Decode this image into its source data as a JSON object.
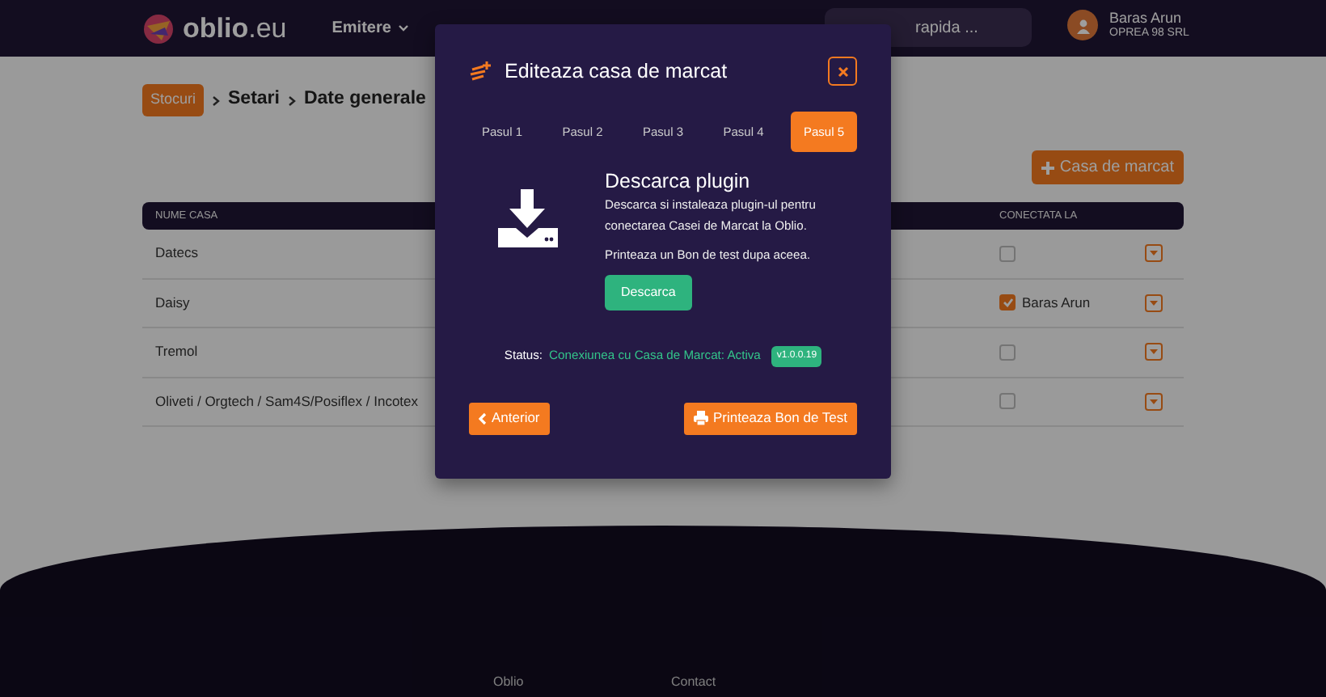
{
  "navbar": {
    "brand": "oblio.eu",
    "menu": [
      {
        "label": "Emitere",
        "dropdown": true
      }
    ],
    "search": {
      "placeholder": "rapida ..."
    },
    "user": {
      "name": "Baras Arun",
      "company": "OPREA 98 SRL"
    }
  },
  "breadcrumb": [
    {
      "label": "Stocuri",
      "kind": "badge"
    },
    {
      "label": "Setari",
      "kind": "text"
    },
    {
      "label": "Date generale",
      "kind": "text"
    }
  ],
  "add_button": {
    "label": "Casa de marcat"
  },
  "table": {
    "columns": [
      "NUME CASA",
      "CONECTATA LA"
    ],
    "rows": [
      {
        "name": "Datecs",
        "connected": false
      },
      {
        "name": "Daisy",
        "connected": true,
        "connected_to": "Baras Arun"
      },
      {
        "name": "Tremol",
        "connected": false
      },
      {
        "name": "Oliveti / Orgtech / Sam4S/Posiflex / Incotex",
        "connected": false
      }
    ]
  },
  "modal": {
    "title": "Editeaza casa de marcat",
    "steps": [
      {
        "label": "Pasul 1",
        "selected": false
      },
      {
        "label": "Pasul 2",
        "selected": false
      },
      {
        "label": "Pasul 3",
        "selected": false
      },
      {
        "label": "Pasul 4",
        "selected": false
      },
      {
        "label": "Pasul 5",
        "selected": true
      }
    ],
    "heading": "Descarca plugin",
    "description": "Descarca si instaleaza plugin-ul pentru conectarea Casei de Marcat la Oblio.",
    "note": "Printeaza un Bon de test dupa aceea.",
    "download_button": "Descarca",
    "status": {
      "label": "Status:",
      "value": "Conexiunea cu Casa de Marcat: Activa",
      "version": "v1.0.0.19"
    },
    "back_button": "Anterior",
    "print_button": "Printeaza Bon de Test"
  },
  "footer": {
    "links": [
      "Oblio",
      "Contact"
    ]
  }
}
